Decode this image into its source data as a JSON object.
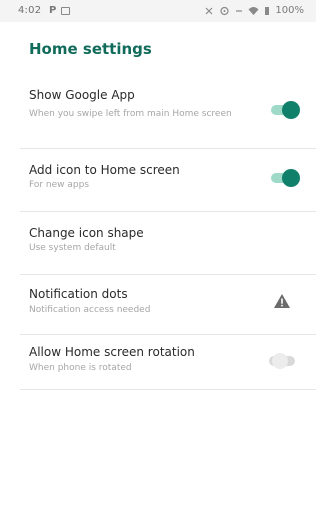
{
  "status_bar": {
    "time": "4:02",
    "battery": "100%"
  },
  "header": {
    "title": "Home settings"
  },
  "settings": [
    {
      "title": "Show Google App",
      "summary": "When you swipe left from main Home screen",
      "control": "toggle",
      "state": "on"
    },
    {
      "title": "Add icon to Home screen",
      "summary": "For new apps",
      "control": "toggle",
      "state": "on"
    },
    {
      "title": "Change icon shape",
      "summary": "Use system default",
      "control": "none"
    },
    {
      "title": "Notification dots",
      "summary": "Notification access needed",
      "control": "warning-icon"
    },
    {
      "title": "Allow Home screen rotation",
      "summary": "When phone is rotated",
      "control": "toggle",
      "state": "off"
    }
  ],
  "colors": {
    "accent": "#116b5a",
    "toggle_on_thumb": "#11806a",
    "toggle_on_track": "#9fd9c7",
    "toggle_off_thumb": "#ececec",
    "toggle_off_track": "#d9d9d9",
    "title_text": "#2a2a2a",
    "summary_text": "#a6a6a6"
  }
}
